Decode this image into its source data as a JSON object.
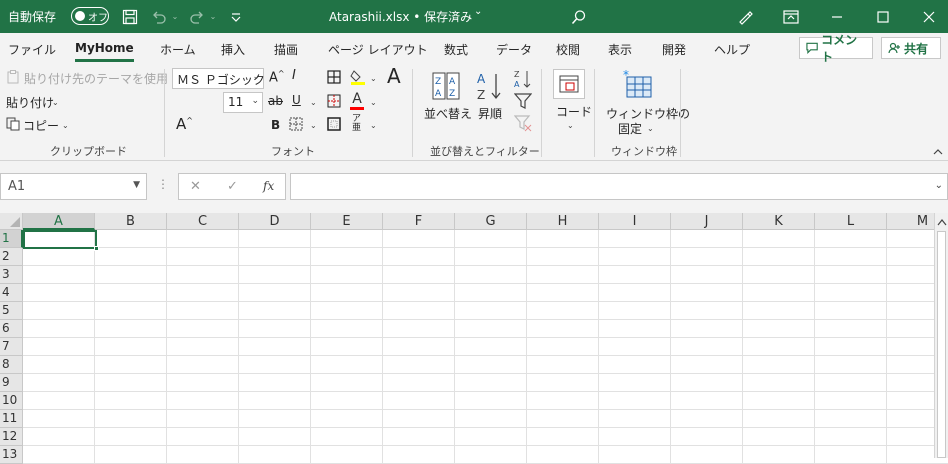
{
  "titlebar": {
    "autosave_label": "自動保存",
    "autosave_state": "オフ",
    "document_title": "Atarashii.xlsx • 保存済み",
    "title_caret": "⌄"
  },
  "tabs": [
    {
      "label": "ファイル"
    },
    {
      "label": "MyHome"
    },
    {
      "label": "ホーム"
    },
    {
      "label": "挿入"
    },
    {
      "label": "描画"
    },
    {
      "label": "ページ レイアウト"
    },
    {
      "label": "数式"
    },
    {
      "label": "データ"
    },
    {
      "label": "校閲"
    },
    {
      "label": "表示"
    },
    {
      "label": "開発"
    },
    {
      "label": "ヘルプ"
    }
  ],
  "tab_buttons": {
    "comment": "コメント",
    "share": "共有"
  },
  "clipboard": {
    "paste_theme": "貼り付け先のテーマを使用",
    "paste": "貼り付け",
    "copy": "コピー",
    "group_label": "クリップボード"
  },
  "font": {
    "font_name": "ＭＳ Ｐゴシック",
    "font_size": "11",
    "group_label": "フォント"
  },
  "sort_filter": {
    "sort_label": "並べ替え",
    "ascending_label": "昇順",
    "group_label": "並び替えとフィルター"
  },
  "code": {
    "label": "コード"
  },
  "window": {
    "freeze_line1": "ウィンドウ枠の",
    "freeze_line2": "固定",
    "group_label": "ウィンドウ枠"
  },
  "formula_bar": {
    "name_box": "A1",
    "fx": "fx",
    "cancel": "✕",
    "enter": "✓",
    "formula": ""
  },
  "grid": {
    "columns": [
      "A",
      "B",
      "C",
      "D",
      "E",
      "F",
      "G",
      "H",
      "I",
      "J",
      "K",
      "L",
      "M"
    ],
    "rows": [
      "1",
      "2",
      "3",
      "4",
      "5",
      "6",
      "7",
      "8",
      "9",
      "10",
      "11",
      "12",
      "13"
    ],
    "active_cell": "A1"
  }
}
